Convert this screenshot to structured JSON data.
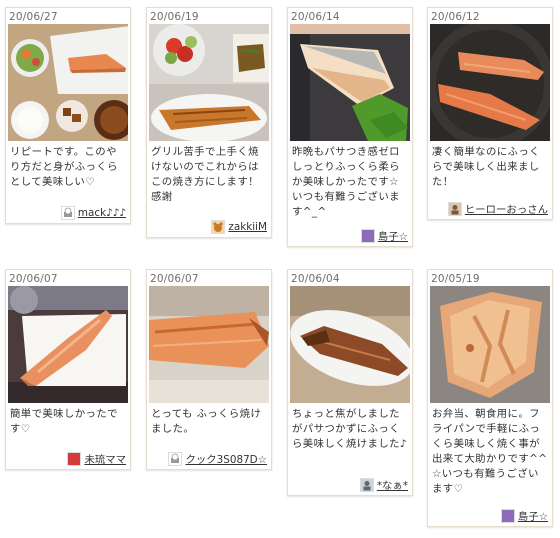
{
  "cards": [
    {
      "date": "20/06/27",
      "comment": "リピートです。このやり方だと身がふっくらとして美味しい♡",
      "author": "mack♪♪♪",
      "avatar_icon": "cooking-avatar-icon"
    },
    {
      "date": "20/06/19",
      "comment": "グリル苦手で上手く焼けないのでこれからはこの焼き方にします！感謝",
      "author": "zakkiiM",
      "avatar_icon": "bear-avatar-icon"
    },
    {
      "date": "20/06/14",
      "comment": "昨晩もパサつき感ゼロしっとりふっくら柔らか美味しかったです☆いつも有難うございます^_^",
      "author": "島子☆",
      "avatar_icon": "purple-avatar-icon"
    },
    {
      "date": "20/06/12",
      "comment": "凄く簡単なのにふっくらで美味しく出来ました！",
      "author": "ヒーローおっさん",
      "avatar_icon": "person-avatar-icon"
    },
    {
      "date": "20/06/07",
      "comment": "簡単で美味しかったです♡",
      "author": "未琉ママ",
      "avatar_icon": "red-avatar-icon"
    },
    {
      "date": "20/06/07",
      "comment": "とっても ふっくら焼けました。",
      "author": "クック3S087D☆",
      "avatar_icon": "cooking-avatar-icon"
    },
    {
      "date": "20/06/04",
      "comment": "ちょっと焦がしましたがパサつかずにふっくら美味しく焼けました♪",
      "author": "*なぁ*",
      "avatar_icon": "person-avatar-icon"
    },
    {
      "date": "20/05/19",
      "comment": "お弁当、朝食用に。フライパンで手軽にふっくら美味しく焼く事が出来て大助かりです^^☆いつも有難うございます♡",
      "author": "島子☆",
      "avatar_icon": "purple-avatar-icon"
    }
  ]
}
